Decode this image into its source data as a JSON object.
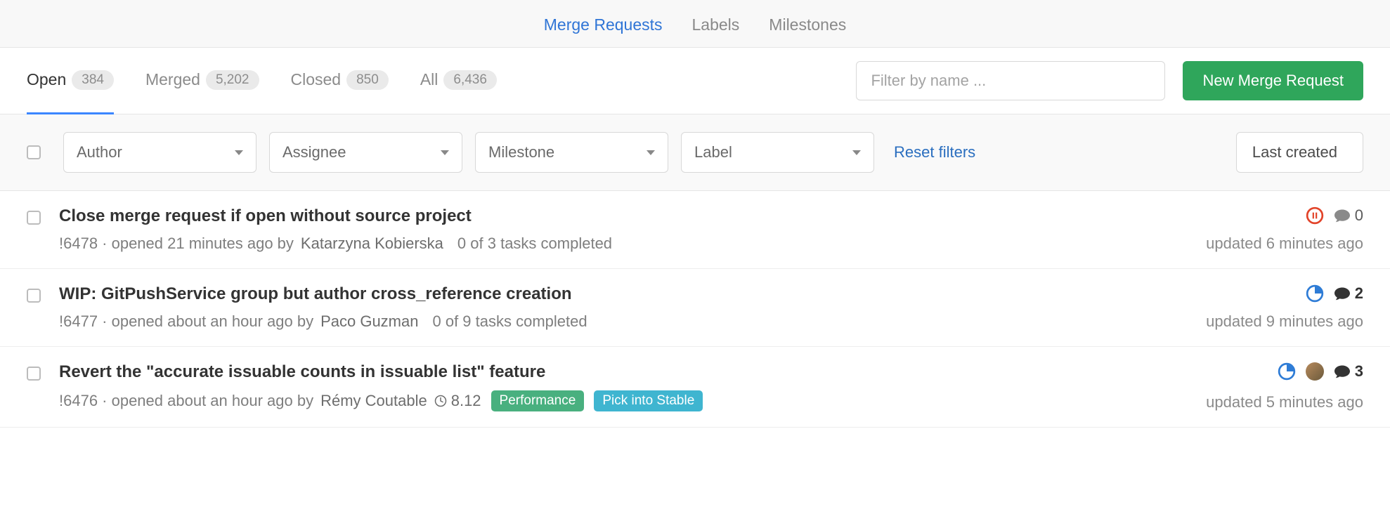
{
  "nav": {
    "items": [
      {
        "label": "Merge Requests",
        "active": true
      },
      {
        "label": "Labels",
        "active": false
      },
      {
        "label": "Milestones",
        "active": false
      }
    ]
  },
  "tabs": {
    "states": [
      {
        "label": "Open",
        "count": "384",
        "active": true
      },
      {
        "label": "Merged",
        "count": "5,202",
        "active": false
      },
      {
        "label": "Closed",
        "count": "850",
        "active": false
      },
      {
        "label": "All",
        "count": "6,436",
        "active": false
      }
    ],
    "filter_placeholder": "Filter by name ...",
    "new_button": "New Merge Request"
  },
  "filters": {
    "dropdowns": [
      "Author",
      "Assignee",
      "Milestone",
      "Label"
    ],
    "reset_label": "Reset filters",
    "sort_label": "Last created"
  },
  "merge_requests": [
    {
      "title": "Close merge request if open without source project",
      "ref": "!6478",
      "opened": "opened 21 minutes ago by",
      "author": "Katarzyna Kobierska",
      "tasks": "0 of 3 tasks completed",
      "milestone": null,
      "labels": [],
      "ci_status": "pending",
      "avatar": false,
      "comments": "0",
      "comments_bold": false,
      "updated": "updated 6 minutes ago"
    },
    {
      "title": "WIP: GitPushService group but author cross_reference creation",
      "ref": "!6477",
      "opened": "opened about an hour ago by",
      "author": "Paco Guzman",
      "tasks": "0 of 9 tasks completed",
      "milestone": null,
      "labels": [],
      "ci_status": "running",
      "avatar": false,
      "comments": "2",
      "comments_bold": true,
      "updated": "updated 9 minutes ago"
    },
    {
      "title": "Revert the \"accurate issuable counts in issuable list\" feature",
      "ref": "!6476",
      "opened": "opened about an hour ago by",
      "author": "Rémy Coutable",
      "tasks": null,
      "milestone": "8.12",
      "labels": [
        {
          "text": "Performance",
          "color": "#49b07f"
        },
        {
          "text": "Pick into Stable",
          "color": "#3fb5d0"
        }
      ],
      "ci_status": "running",
      "avatar": true,
      "comments": "3",
      "comments_bold": true,
      "updated": "updated 5 minutes ago"
    }
  ]
}
